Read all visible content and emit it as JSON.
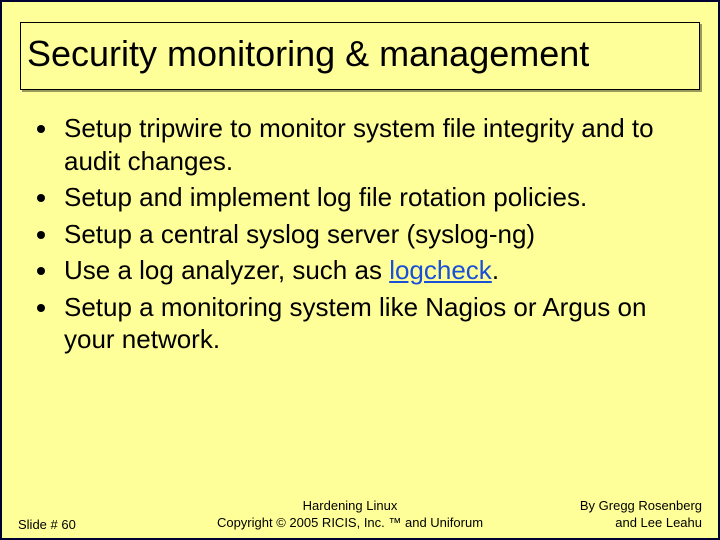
{
  "title": "Security monitoring & management",
  "bullets": [
    {
      "pre": "Setup tripwire to monitor system file integrity and to audit changes.",
      "link": "",
      "post": ""
    },
    {
      "pre": "Setup and implement log file rotation policies.",
      "link": "",
      "post": ""
    },
    {
      "pre": "Setup a central syslog server (syslog-ng)",
      "link": "",
      "post": ""
    },
    {
      "pre": "Use a log analyzer, such as ",
      "link": "logcheck",
      "post": "."
    },
    {
      "pre": "Setup a monitoring system like Nagios or Argus on your network.",
      "link": "",
      "post": ""
    }
  ],
  "footer": {
    "slide_number": "Slide # 60",
    "center1": "Hardening Linux",
    "center2": "Copyright © 2005 RICIS, Inc. ™ and Uniforum",
    "right1": "By Gregg Rosenberg",
    "right2": "and Lee Leahu"
  }
}
